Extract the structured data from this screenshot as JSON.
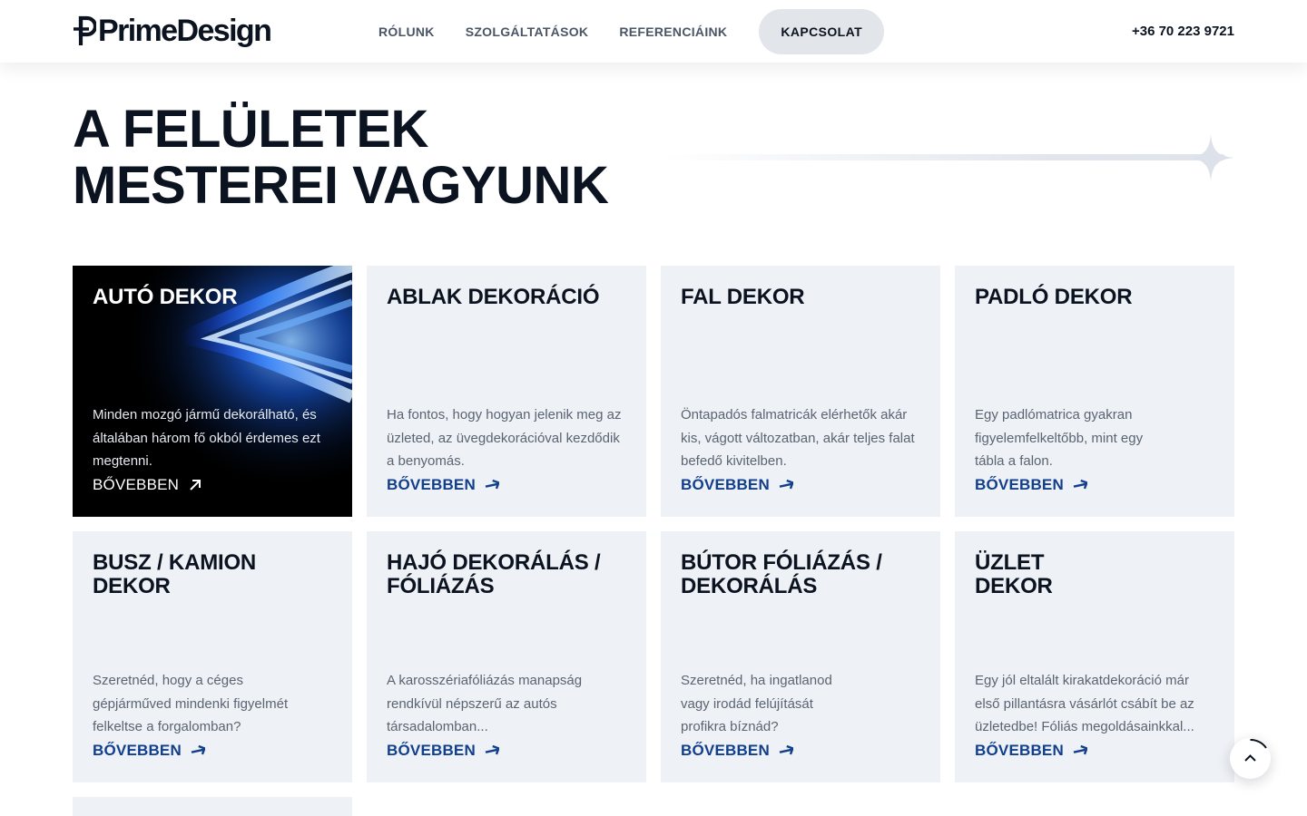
{
  "header": {
    "logo_text": "PrimeDesign",
    "nav": [
      "RÓLUNK",
      "SZOLGÁLTATÁSOK",
      "REFERENCIÁINK"
    ],
    "cta": "KAPCSOLAT",
    "phone": "+36 70 223 9721"
  },
  "hero": {
    "title_line1": "A FELÜLETEK",
    "title_line2": "MESTEREI VAGYUNK"
  },
  "cards": [
    {
      "title": "AUTÓ DEKOR",
      "desc": "Minden mozgó jármű dekorálható, és általában három fő okból érdemes ezt megtenni.",
      "link": "BŐVEBBEN"
    },
    {
      "title": "ABLAK DEKORÁCIÓ",
      "desc": "Ha fontos, hogy hogyan jelenik meg az üzleted, az üvegdekorációval kezdődik a benyomás.",
      "link": "BŐVEBBEN"
    },
    {
      "title": "FAL DEKOR",
      "desc": "Öntapadós falmatricák elérhetők akár kis, vágott változatban, akár teljes falat befedő kivitelben.",
      "link": "BŐVEBBEN"
    },
    {
      "title": "PADLÓ DEKOR",
      "desc": "Egy padlómatrica gyakran figyelemfelkeltőbb, mint egy tábla a falon.",
      "link": "BŐVEBBEN"
    },
    {
      "title": "BUSZ / KAMION DEKOR",
      "desc": "Szeretnéd, hogy a céges gépjárműved mindenki figyelmét felkeltse a forgalomban?",
      "link": "BŐVEBBEN"
    },
    {
      "title": "HAJÓ DEKORÁLÁS / FÓLIÁZÁS",
      "desc": "A karosszériafóliázás manapság rendkívül népszerű az autós társadalomban...",
      "link": "BŐVEBBEN"
    },
    {
      "title": "BÚTOR FÓLIÁZÁS / DEKORÁLÁS",
      "desc": "Szeretnéd, ha ingatlanod vagy irodád felújítását profikra bíznád?",
      "link": "BŐVEBBEN"
    },
    {
      "title": "ÜZLET DEKOR",
      "desc": "Egy jól eltalált kirakatdekoráció már első pillantásra vásárlót csábít be az üzletedbe! Fóliás megoldásainkkal...",
      "link": "BŐVEBBEN"
    }
  ],
  "colors": {
    "accent": "#123f8c",
    "card_bg": "#eef1f5",
    "cta_bg": "#e2e5ea"
  }
}
